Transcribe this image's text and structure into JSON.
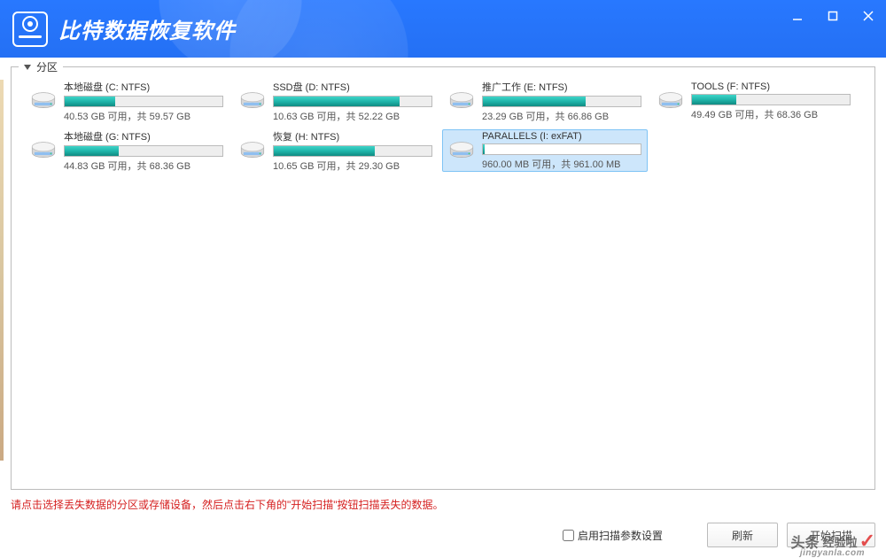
{
  "header": {
    "app_title": "比特数据恢复软件"
  },
  "section": {
    "label": "分区"
  },
  "drives": [
    {
      "name": "本地磁盘 (C: NTFS)",
      "free": "40.53 GB",
      "total": "59.57 GB",
      "pct": 32
    },
    {
      "name": "SSD盘 (D: NTFS)",
      "free": "10.63 GB",
      "total": "52.22 GB",
      "pct": 80
    },
    {
      "name": "推广工作 (E: NTFS)",
      "free": "23.29 GB",
      "total": "66.86 GB",
      "pct": 65
    },
    {
      "name": "TOOLS (F: NTFS)",
      "free": "49.49 GB",
      "total": "68.36 GB",
      "pct": 28
    },
    {
      "name": "本地磁盘 (G: NTFS)",
      "free": "44.83 GB",
      "total": "68.36 GB",
      "pct": 34
    },
    {
      "name": "恢复 (H: NTFS)",
      "free": "10.65 GB",
      "total": "29.30 GB",
      "pct": 64
    },
    {
      "name": "PARALLELS (I: exFAT)",
      "free": "960.00 MB",
      "total": "961.00 MB",
      "pct": 1,
      "selected": true
    }
  ],
  "hint": "请点击选择丢失数据的分区或存储设备，然后点击右下角的\"开始扫描\"按钮扫描丢失的数据。",
  "footer": {
    "checkbox_label": "启用扫描参数设置",
    "refresh_label": "刷新",
    "start_label": "开始扫描"
  },
  "labels": {
    "free_word": "可用",
    "sep": "，共 "
  },
  "watermark": {
    "brand": "经验啦",
    "url": "jingyanla.com",
    "prefix": "头条"
  }
}
